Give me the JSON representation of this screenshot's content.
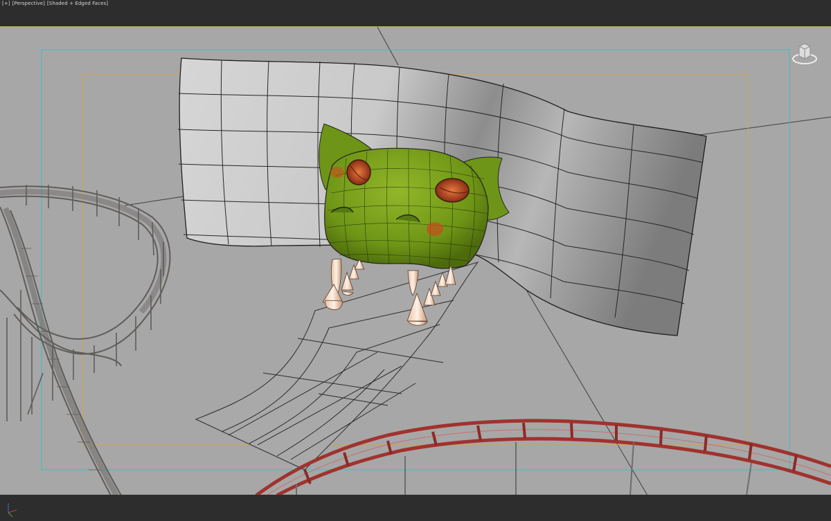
{
  "viewport": {
    "labels": {
      "plus": "[+]",
      "view": "[Perspective]",
      "shading": "[Shaded + Edged Faces]"
    }
  },
  "icons": {
    "viewcube": "viewcube-home-icon",
    "axis": "axis-tripod-icon"
  },
  "colors": {
    "viewport_bg": "#a7a7a7",
    "ui_bg": "#2d2d2d",
    "safe_frame_outer": "#39c0c0",
    "safe_frame_inner": "#d3a441",
    "creature_green": "#7aa11f",
    "rail_red": "#a0322d",
    "coaster_track": "#676460"
  }
}
